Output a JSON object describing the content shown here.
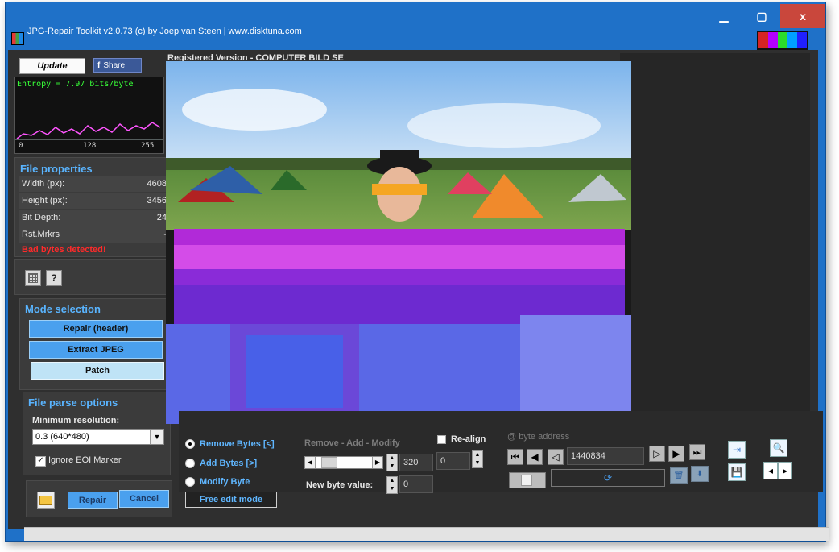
{
  "window": {
    "title": "JPG-Repair Toolkit v2.0.73 (c) by Joep van Steen | www.disktuna.com",
    "min_glyph": "▁",
    "max_glyph": "▢",
    "close_glyph": "x"
  },
  "left": {
    "update_label": "Update",
    "share_label": "Share",
    "share_icon_glyph": "f",
    "entropy_text": "Entropy = 7.97 bits/byte",
    "histogram_axis": [
      "0",
      "128",
      "255"
    ],
    "file_properties_title": "File properties",
    "properties": [
      {
        "key": "Width (px):",
        "value": "4608"
      },
      {
        "key": "Height (px):",
        "value": "3456"
      },
      {
        "key": "Bit Depth:",
        "value": "24"
      },
      {
        "key": "Rst.Mrkrs",
        "value": "-"
      }
    ],
    "warning": "Bad bytes detected!",
    "help_glyph": "?",
    "mode_title": "Mode selection",
    "mode_buttons": [
      "Repair (header)",
      "Extract JPEG",
      "Patch"
    ],
    "parse_title": "File parse options",
    "min_res_label": "Minimum resolution:",
    "min_res_value": "0.3 (640*480)",
    "ignore_eoi_label": "Ignore EOI Marker",
    "ignore_eoi_checked": true,
    "repair_label": "Repair",
    "cancel_label": "Cancel"
  },
  "main": {
    "registered": "Registered Version - COMPUTER BILD SE"
  },
  "bottom": {
    "radios": [
      {
        "label": "Remove Bytes [<]",
        "selected": true
      },
      {
        "label": "Add Bytes [>]",
        "selected": false
      },
      {
        "label": "Modify Byte",
        "selected": false
      }
    ],
    "free_edit_label": "Free edit mode",
    "ram_label": "Remove - Add - Modify",
    "slider_value": "320",
    "realign_label": "Re-align",
    "realign_value": "0",
    "new_byte_label": "New byte value:",
    "new_byte_value": "0",
    "byte_address_label": "@ byte address",
    "byte_address_value": "1440834"
  },
  "colors": {
    "title_bar": "#1f71c8",
    "accent_blue": "#4aa0ee",
    "section_title": "#59b4ff",
    "warning": "#ff2a2a"
  }
}
